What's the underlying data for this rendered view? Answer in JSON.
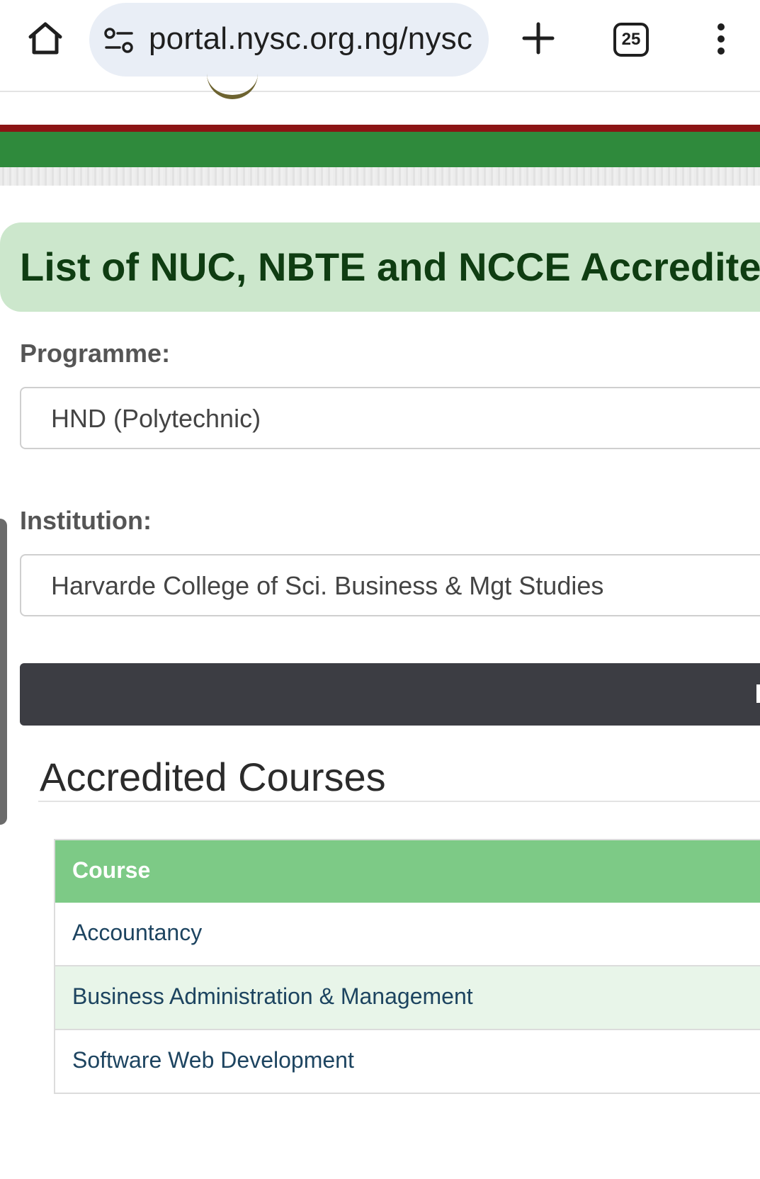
{
  "browser": {
    "url": "portal.nysc.org.ng/nysc",
    "tab_count": "25"
  },
  "page": {
    "title": "List of NUC, NBTE and NCCE Accredited Co",
    "programme_label": "Programme:",
    "programme_value": "HND (Polytechnic)",
    "institution_label": "Institution:",
    "institution_value": "Harvarde College of Sci. Business & Mgt Studies",
    "section_title": "Accredited Courses"
  },
  "table": {
    "header": "Course",
    "rows": [
      "Accountancy",
      "Business Administration & Management",
      "Software Web Development"
    ]
  },
  "colors": {
    "brand_green": "#2f8a3c",
    "brand_red": "#8b1414",
    "banner_bg": "#cce7cc",
    "table_header": "#7dca86"
  },
  "icons": [
    "home-icon",
    "site-settings-icon",
    "plus-icon",
    "tab-switcher-icon",
    "more-vert-icon"
  ]
}
